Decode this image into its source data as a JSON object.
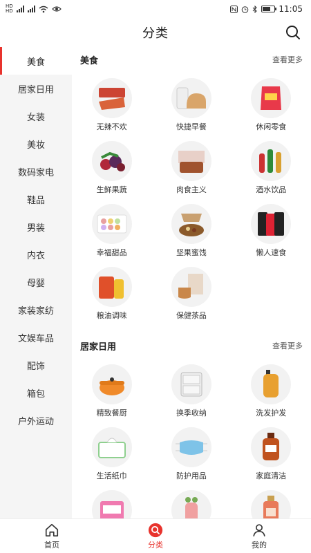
{
  "status": {
    "time": "11:05",
    "sim1": "HD",
    "sim2": "HD",
    "net": "4G"
  },
  "header": {
    "title": "分类"
  },
  "sidebar": {
    "items": [
      {
        "label": "美食",
        "active": true
      },
      {
        "label": "居家日用"
      },
      {
        "label": "女装"
      },
      {
        "label": "美妆"
      },
      {
        "label": "数码家电"
      },
      {
        "label": "鞋品"
      },
      {
        "label": "男装"
      },
      {
        "label": "内衣"
      },
      {
        "label": "母婴"
      },
      {
        "label": "家装家纺"
      },
      {
        "label": "文娱车品"
      },
      {
        "label": "配饰"
      },
      {
        "label": "箱包"
      },
      {
        "label": "户外运动"
      }
    ]
  },
  "sections": [
    {
      "title": "美食",
      "more": "查看更多",
      "items": [
        {
          "label": "无辣不欢",
          "icon": "spicy-meat-icon",
          "color": "#d9633a"
        },
        {
          "label": "快捷早餐",
          "icon": "bread-icon",
          "color": "#d9a56a"
        },
        {
          "label": "休闲零食",
          "icon": "snack-bag-icon",
          "color": "#e8394a"
        },
        {
          "label": "生鲜果蔬",
          "icon": "fruit-icon",
          "color": "#b0283a"
        },
        {
          "label": "肉食主义",
          "icon": "meat-box-icon",
          "color": "#a0522d"
        },
        {
          "label": "酒水饮品",
          "icon": "drinks-icon",
          "color": "#2e8b3a"
        },
        {
          "label": "幸福甜品",
          "icon": "macaron-icon",
          "color": "#e8a0a0"
        },
        {
          "label": "坚果蜜饯",
          "icon": "nuts-icon",
          "color": "#8b5a2b"
        },
        {
          "label": "懒人速食",
          "icon": "noodle-icon",
          "color": "#222222"
        },
        {
          "label": "粮油调味",
          "icon": "rice-oil-icon",
          "color": "#e0502a"
        },
        {
          "label": "保健茶品",
          "icon": "tea-icon",
          "color": "#c9874a"
        }
      ]
    },
    {
      "title": "居家日用",
      "more": "查看更多",
      "items": [
        {
          "label": "精致餐厨",
          "icon": "pot-icon",
          "color": "#f08a2a"
        },
        {
          "label": "换季收纳",
          "icon": "drawer-icon",
          "color": "#d8d8d8"
        },
        {
          "label": "洗发护发",
          "icon": "shampoo-icon",
          "color": "#e8a030"
        },
        {
          "label": "生活纸巾",
          "icon": "tissue-icon",
          "color": "#8fd08f"
        },
        {
          "label": "防护用品",
          "icon": "mask-icon",
          "color": "#7ec3e8"
        },
        {
          "label": "家庭清洁",
          "icon": "cleaner-icon",
          "color": "#c0521e"
        },
        {
          "label": "",
          "icon": "pink-pack-icon",
          "color": "#f07ab0"
        },
        {
          "label": "",
          "icon": "bottle-icon",
          "color": "#f0a0a0"
        },
        {
          "label": "",
          "icon": "perfume-icon",
          "color": "#e87a5a"
        }
      ]
    }
  ],
  "tabbar": {
    "items": [
      {
        "label": "首页",
        "icon": "home-icon"
      },
      {
        "label": "分类",
        "icon": "category-search-icon",
        "active": true
      },
      {
        "label": "我的",
        "icon": "user-icon"
      }
    ]
  },
  "colors": {
    "accent": "#e8332d",
    "sidebar_bg": "#f5f5f5"
  }
}
